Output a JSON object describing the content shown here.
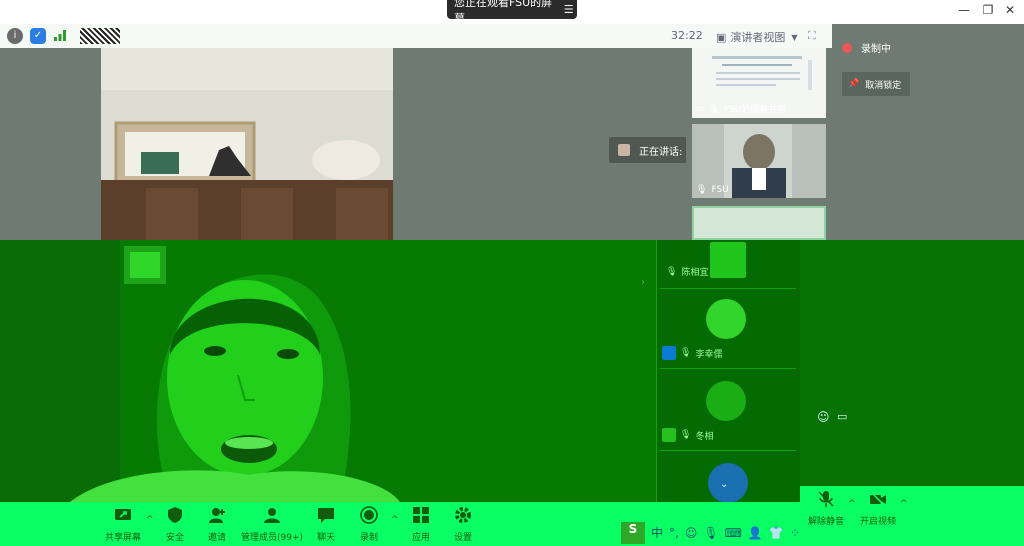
{
  "banner": {
    "text": "您正在观看FSU的屏幕",
    "menu_glyph": "☰"
  },
  "window": {
    "minimize": "—",
    "restore": "❐",
    "close": "✕"
  },
  "status": {
    "timer": "32:22",
    "speaker_view": "演讲者视图"
  },
  "speaking": {
    "text": "正在讲话: 陈相宜;"
  },
  "thumbnails": [
    {
      "label": "FSU的屏幕共享"
    },
    {
      "label": "FSU"
    }
  ],
  "recording": {
    "status": "录制中",
    "unpin": "取消锁定"
  },
  "participants": [
    {
      "name": "陈相宜"
    },
    {
      "name": "李幸儒"
    },
    {
      "name": "冬相"
    }
  ],
  "toolbar": {
    "items": [
      {
        "label": "共享屏幕",
        "icon": "screen-share-icon"
      },
      {
        "label": "安全",
        "icon": "shield-icon"
      },
      {
        "label": "邀请",
        "icon": "invite-icon"
      },
      {
        "label": "管理成员(99+)",
        "icon": "members-icon"
      },
      {
        "label": "聊天",
        "icon": "chat-icon"
      },
      {
        "label": "录制",
        "icon": "record-icon"
      },
      {
        "label": "应用",
        "icon": "apps-icon"
      },
      {
        "label": "设置",
        "icon": "gear-icon"
      }
    ],
    "unmute": "解除静音",
    "start_video": "开启视频"
  },
  "ime": {
    "mode": "中"
  },
  "colors": {
    "bright_green": "#0aff64",
    "dark_green": "#057203",
    "gray": "#6f7a72",
    "rec_red": "#e8585b"
  }
}
